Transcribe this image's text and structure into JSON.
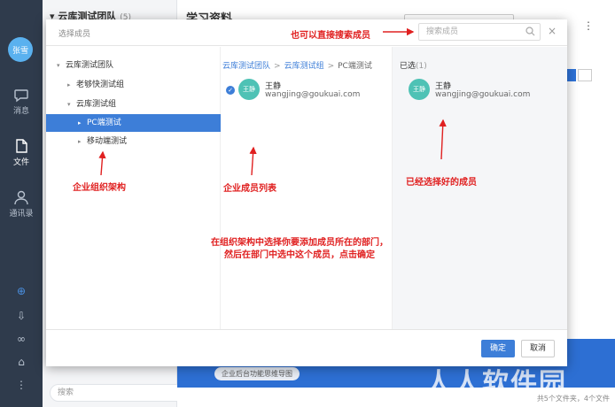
{
  "nav": {
    "avatar": "张雪",
    "items": [
      {
        "label": "消息"
      },
      {
        "label": "文件"
      },
      {
        "label": "通讯录"
      }
    ]
  },
  "background": {
    "team_name": "云库测试团队",
    "team_count": "(5)",
    "page_title": "学习资料",
    "bottom_search_placeholder": "搜索",
    "pill_text": "企业后台功能思维导图",
    "status_text": "共5个文件夹，4个文件",
    "watermark": "人人软件园"
  },
  "dialog": {
    "title": "选择成员",
    "search_placeholder": "搜索成员",
    "close": "×",
    "tree": [
      {
        "label": "云库测试团队",
        "arrow": "▾"
      },
      {
        "label": "老够快测试组",
        "arrow": "▸"
      },
      {
        "label": "云库测试组",
        "arrow": "▾"
      },
      {
        "label": "PC端测试",
        "arrow": "▸"
      },
      {
        "label": "移动端测试",
        "arrow": "▸"
      }
    ],
    "breadcrumb": [
      "云库测试团队",
      "云库测试组",
      "PC端测试"
    ],
    "members": [
      {
        "avatar": "王静",
        "name": "王静",
        "email": "wangjing@goukuai.com"
      }
    ],
    "selected_label": "已选",
    "selected_count": "(1)",
    "selected": [
      {
        "avatar": "王静",
        "name": "王静",
        "email": "wangjing@goukuai.com"
      }
    ],
    "ok_label": "确定",
    "cancel_label": "取消"
  },
  "annotations": {
    "search_hint": "也可以直接搜索成员",
    "org_tree": "企业组织架构",
    "member_list": "企业成员列表",
    "selected_members": "已经选择好的成员",
    "instructions": "在组织架构中选择你要添加成员所在的部门，然后在部门中选中这个成员，点击确定"
  },
  "colors": {
    "annotation": "#e02020",
    "accent": "#3d7ed8",
    "rail": "#2f3b4c"
  }
}
